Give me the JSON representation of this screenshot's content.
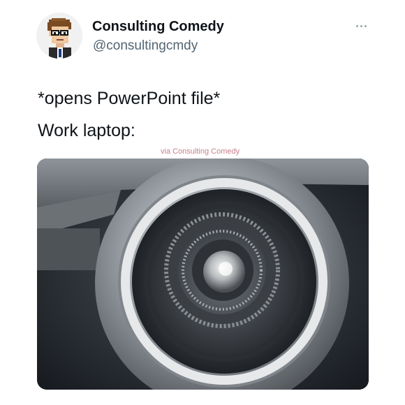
{
  "tweet": {
    "author": {
      "display_name": "Consulting Comedy",
      "handle": "@consultingcmdy",
      "avatar_icon": "pixel-art-man-with-glasses-avatar"
    },
    "more_icon": "more-horizontal-icon",
    "text_lines": [
      "*opens PowerPoint file*",
      "Work laptop:"
    ],
    "watermark": "via Consulting Comedy",
    "media": {
      "image_subject": "close-up of a jet engine intake and fan blades"
    }
  },
  "colors": {
    "text_primary": "#0f1419",
    "text_secondary": "#536471",
    "watermark": "#c77f8c"
  }
}
